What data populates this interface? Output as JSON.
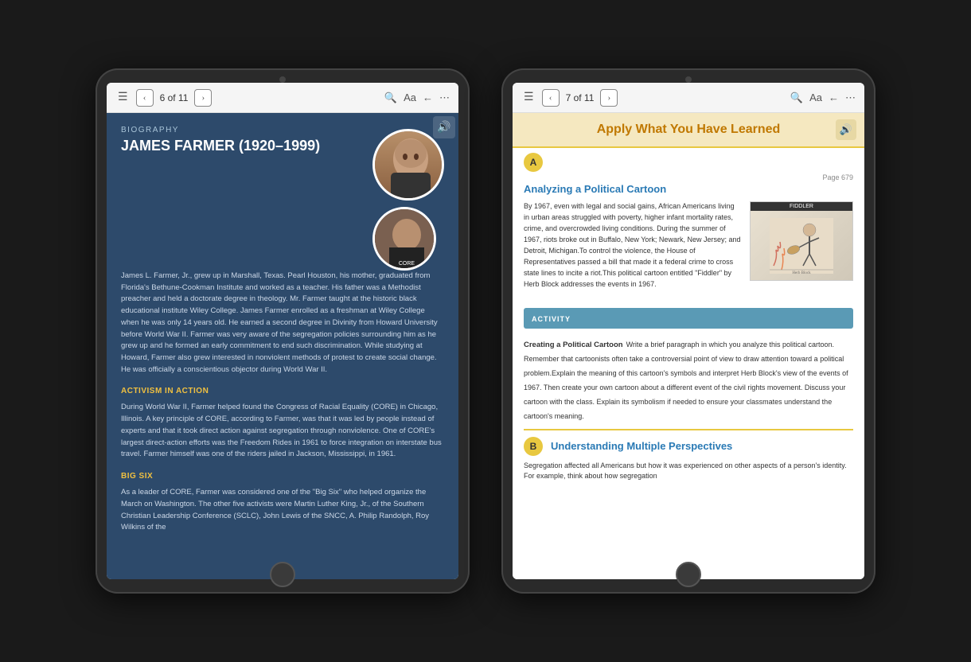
{
  "left_tablet": {
    "toolbar": {
      "menu_icon": "☰",
      "prev_icon": "‹",
      "page_indicator": "6 of 11",
      "next_icon": "›",
      "search_icon": "🔍",
      "font_icon": "Aa",
      "back_icon": "←",
      "more_icon": "⋯"
    },
    "content": {
      "biography_label": "BIOGRAPHY",
      "biography_title": "JAMES FARMER (1920–1999)",
      "bio_paragraph": "James L. Farmer, Jr., grew up in Marshall, Texas. Pearl Houston, his mother, graduated from Florida's Bethune-Cookman Institute and worked as a teacher. His father was a Methodist preacher and held a doctorate degree in theology. Mr. Farmer taught at the historic black educational institute Wiley College. James Farmer enrolled as a freshman at Wiley College when he was only 14 years old. He earned a second degree in Divinity from Howard University before World War II. Farmer was very aware of the segregation policies surrounding him as he grew up and he formed an early commitment to end such discrimination. While studying at Howard, Farmer also grew interested in nonviolent methods of protest to create social change. He was officially a conscientious objector during World War II.",
      "activism_heading": "ACTIVISM IN ACTION",
      "activism_paragraph": "During World War II, Farmer helped found the Congress of Racial Equality (CORE) in Chicago, Illinois. A key principle of CORE, according to Farmer, was that it was led by people instead of experts and that it took direct action against segregation through nonviolence. One of CORE's largest direct-action efforts was the Freedom Rides in 1961 to force integration on interstate bus travel. Farmer himself was one of the riders jailed in Jackson, Mississippi, in 1961.",
      "big_six_heading": "BIG SIX",
      "big_six_paragraph": "As a leader of CORE, Farmer was considered one of the \"Big Six\" who helped organize the March on Washington. The other five activists were Martin Luther King, Jr., of the Southern Christian Leadership Conference (SCLC), John Lewis of the SNCC, A. Philip Randolph, Roy Wilkins of the",
      "audio_icon": "🔊"
    }
  },
  "right_tablet": {
    "toolbar": {
      "menu_icon": "☰",
      "prev_icon": "‹",
      "page_indicator": "7 of 11",
      "next_icon": "›",
      "search_icon": "🔍",
      "font_icon": "Aa",
      "back_icon": "←",
      "more_icon": "⋯"
    },
    "content": {
      "header_title": "Apply What You Have Learned",
      "audio_icon": "🔊",
      "page_number": "Page 679",
      "section_a_label": "A",
      "section_a_title": "Analyzing a Political Cartoon",
      "section_a_paragraph": "By 1967, even with legal and social gains, African Americans living in urban areas struggled with poverty, higher infant mortality rates, crime, and overcrowded living conditions. During the summer of 1967, riots broke out in Buffalo, New York; Newark, New Jersey; and Detroit, Michigan.To control the violence, the House of Representatives passed a bill that made it a federal crime to cross state lines to incite a riot.This political cartoon entitled \"Fiddler\" by Herb Block addresses the events in 1967.",
      "cartoon_title": "FIDDLER",
      "activity_label": "ACTIVITY",
      "activity_title": "Creating a Political Cartoon",
      "activity_text": "Write a brief paragraph in which you analyze this political cartoon. Remember that cartoonists often take a controversial point of view to draw attention toward a political problem.Explain the meaning of this cartoon's symbols and interpret Herb Block's view of the events of 1967. Then create your own cartoon about a different event of the civil rights movement. Discuss your cartoon with the class. Explain its symbolism if needed to ensure your classmates understand the cartoon's meaning.",
      "section_b_label": "B",
      "section_b_title": "Understanding Multiple Perspectives",
      "section_b_text": "Segregation affected all Americans but how it was experienced on other aspects of a person's identity. For example, think about how segregation"
    }
  }
}
